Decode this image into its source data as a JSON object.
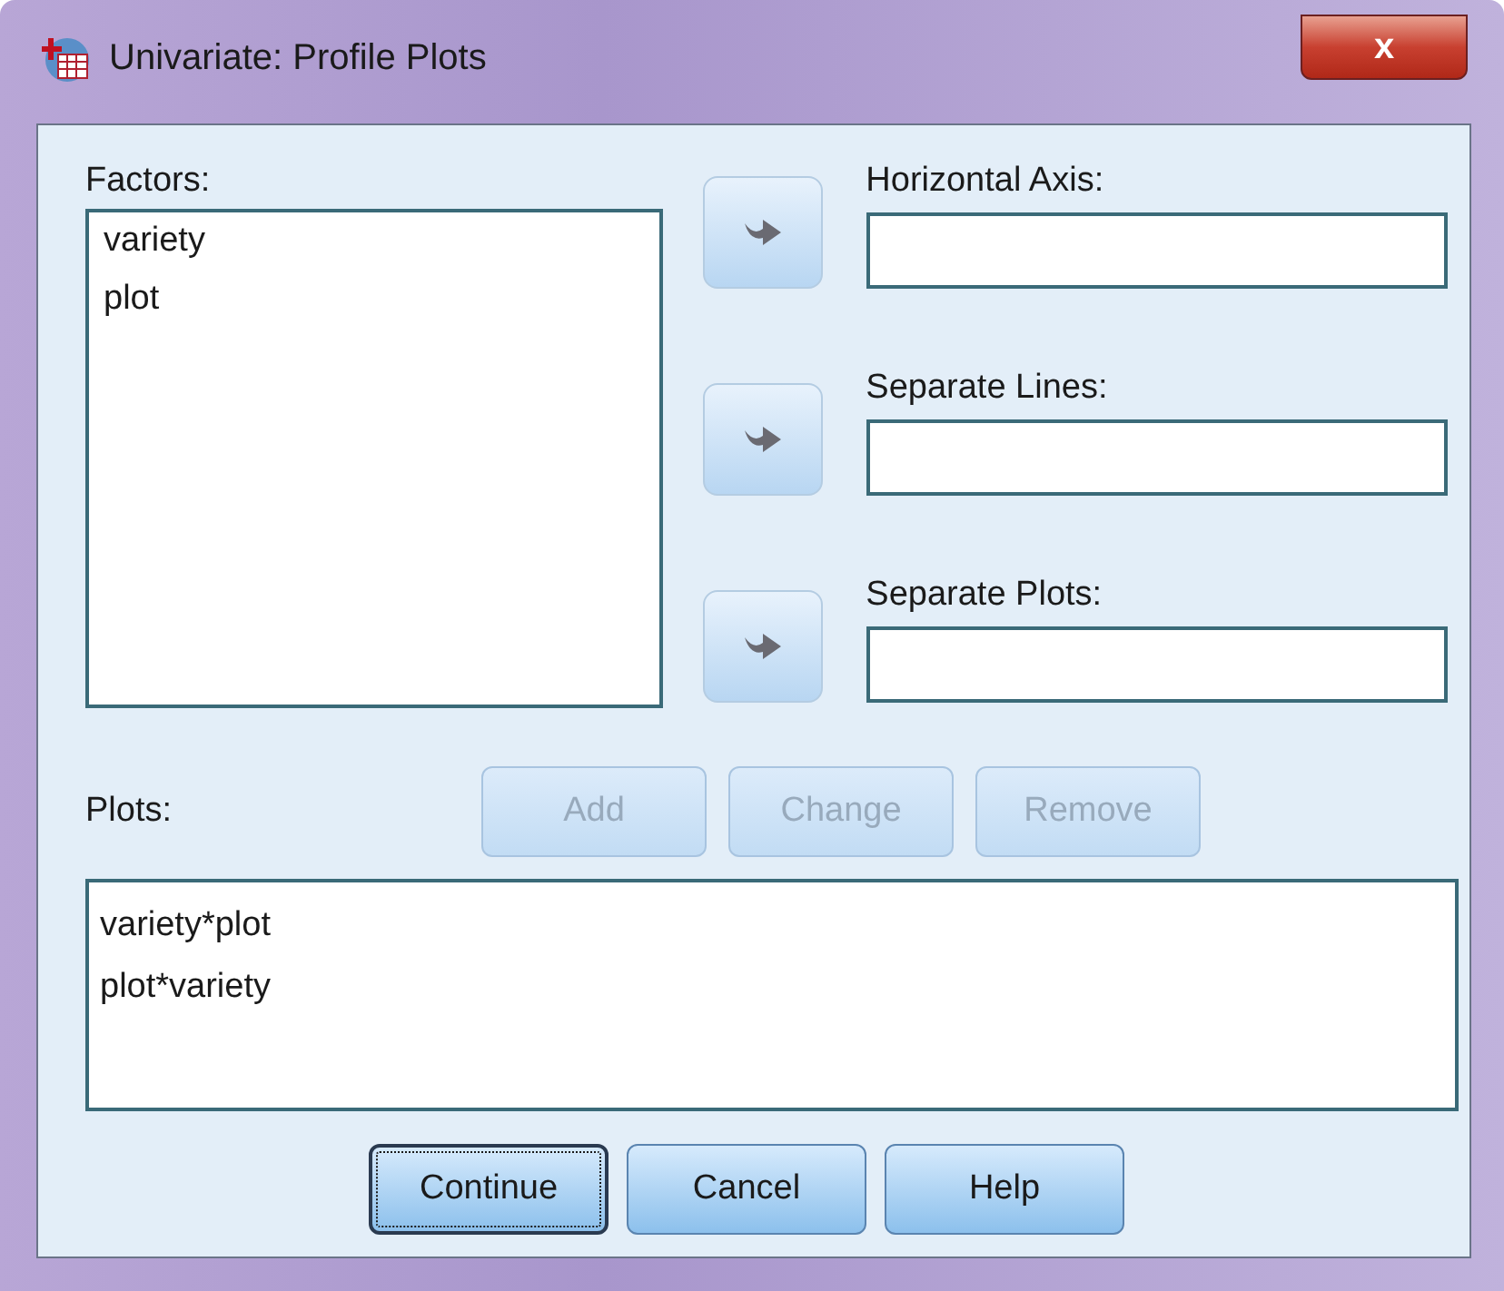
{
  "window": {
    "title": "Univariate: Profile Plots",
    "close": "x"
  },
  "factors": {
    "label": "Factors:",
    "items": [
      {
        "text": "variety",
        "selected": false
      },
      {
        "text": "plot",
        "selected": false
      }
    ]
  },
  "targets": [
    {
      "label": "Horizontal Axis:"
    },
    {
      "label": "Separate Lines:"
    },
    {
      "label": "Separate Plots:"
    }
  ],
  "plots": {
    "label": "Plots:",
    "buttons": [
      {
        "label": "Add",
        "disabled": true
      },
      {
        "label": "Change",
        "disabled": true
      },
      {
        "label": "Remove",
        "disabled": true
      }
    ],
    "items": [
      {
        "text": "variety*plot",
        "selected": false
      },
      {
        "text": "plot*variety",
        "selected": false
      }
    ]
  },
  "buttons": [
    {
      "label": "Continue",
      "focused": true
    },
    {
      "label": "Cancel",
      "focused": false
    },
    {
      "label": "Help",
      "focused": false
    }
  ]
}
